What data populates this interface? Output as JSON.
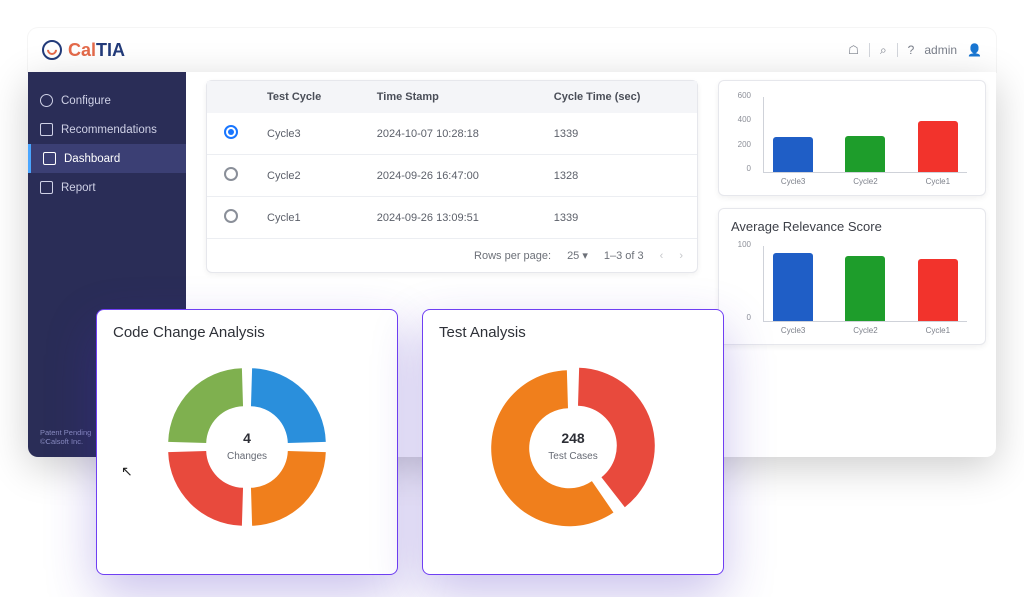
{
  "domain": "Computer-Use",
  "app": {
    "brand_pre": "Cal",
    "brand_suf": "TIA",
    "user": "admin"
  },
  "sidebar": {
    "items": [
      {
        "label": "Configure"
      },
      {
        "label": "Recommendations"
      },
      {
        "label": "Dashboard"
      },
      {
        "label": "Report"
      }
    ],
    "footer_line1": "Patent Pending",
    "footer_line2": "©Calsoft Inc."
  },
  "table": {
    "headers": {
      "c0": "",
      "c1": "Test Cycle",
      "c2": "Time Stamp",
      "c3": "Cycle Time (sec)"
    },
    "rows": [
      {
        "selected": true,
        "cycle": "Cycle3",
        "ts": "2024-10-07 10:28:18",
        "time": "1339"
      },
      {
        "selected": false,
        "cycle": "Cycle2",
        "ts": "2024-09-26 16:47:00",
        "time": "1328"
      },
      {
        "selected": false,
        "cycle": "Cycle1",
        "ts": "2024-09-26 13:09:51",
        "time": "1339"
      }
    ],
    "pager": {
      "rows_label": "Rows per page:",
      "rows_value": "25",
      "range": "1–3 of 3"
    }
  },
  "right_panels": {
    "top_chart_title": "",
    "bottom_chart_title": "Average Relevance Score"
  },
  "overlays": {
    "code_title": "Code Change Analysis",
    "code_num": "4",
    "code_lbl": "Changes",
    "test_title": "Test Analysis",
    "test_num": "248",
    "test_lbl": "Test Cases"
  },
  "colors": {
    "blue": "#1f5ec6",
    "green": "#1e9d2b",
    "red": "#f2332c",
    "orange": "#f07f1c",
    "cyan_seg": "#2a8fdc",
    "green_seg": "#7fb04f",
    "red_seg": "#e84a3d"
  },
  "chart_data": [
    {
      "id": "cycle_time_bar",
      "type": "bar",
      "title": "",
      "categories": [
        "Cycle3",
        "Cycle2",
        "Cycle1"
      ],
      "values": [
        280,
        285,
        400
      ],
      "colors": [
        "#1f5ec6",
        "#1e9d2b",
        "#f2332c"
      ],
      "ylim": [
        0,
        600
      ],
      "yticks": [
        0,
        200,
        400,
        600
      ]
    },
    {
      "id": "avg_relevance_bar",
      "type": "bar",
      "title": "Average Relevance Score",
      "categories": [
        "Cycle3",
        "Cycle2",
        "Cycle1"
      ],
      "values": [
        90,
        85,
        82
      ],
      "colors": [
        "#1f5ec6",
        "#1e9d2b",
        "#f2332c"
      ],
      "ylim": [
        0,
        100
      ],
      "yticks": [
        0,
        100
      ]
    },
    {
      "id": "code_change_donut",
      "type": "pie",
      "title": "Code Change Analysis",
      "total_label": "Changes",
      "total_value": 4,
      "series": [
        {
          "name": "seg1",
          "value": 1,
          "color": "#2a8fdc"
        },
        {
          "name": "seg2",
          "value": 1,
          "color": "#f07f1c"
        },
        {
          "name": "seg3",
          "value": 1,
          "color": "#e84a3d"
        },
        {
          "name": "seg4",
          "value": 1,
          "color": "#7fb04f"
        }
      ]
    },
    {
      "id": "test_analysis_donut",
      "type": "pie",
      "title": "Test Analysis",
      "total_label": "Test Cases",
      "total_value": 248,
      "series": [
        {
          "name": "seg1",
          "value": 99,
          "color": "#e84a3d"
        },
        {
          "name": "seg2",
          "value": 149,
          "color": "#f07f1c"
        }
      ]
    }
  ]
}
